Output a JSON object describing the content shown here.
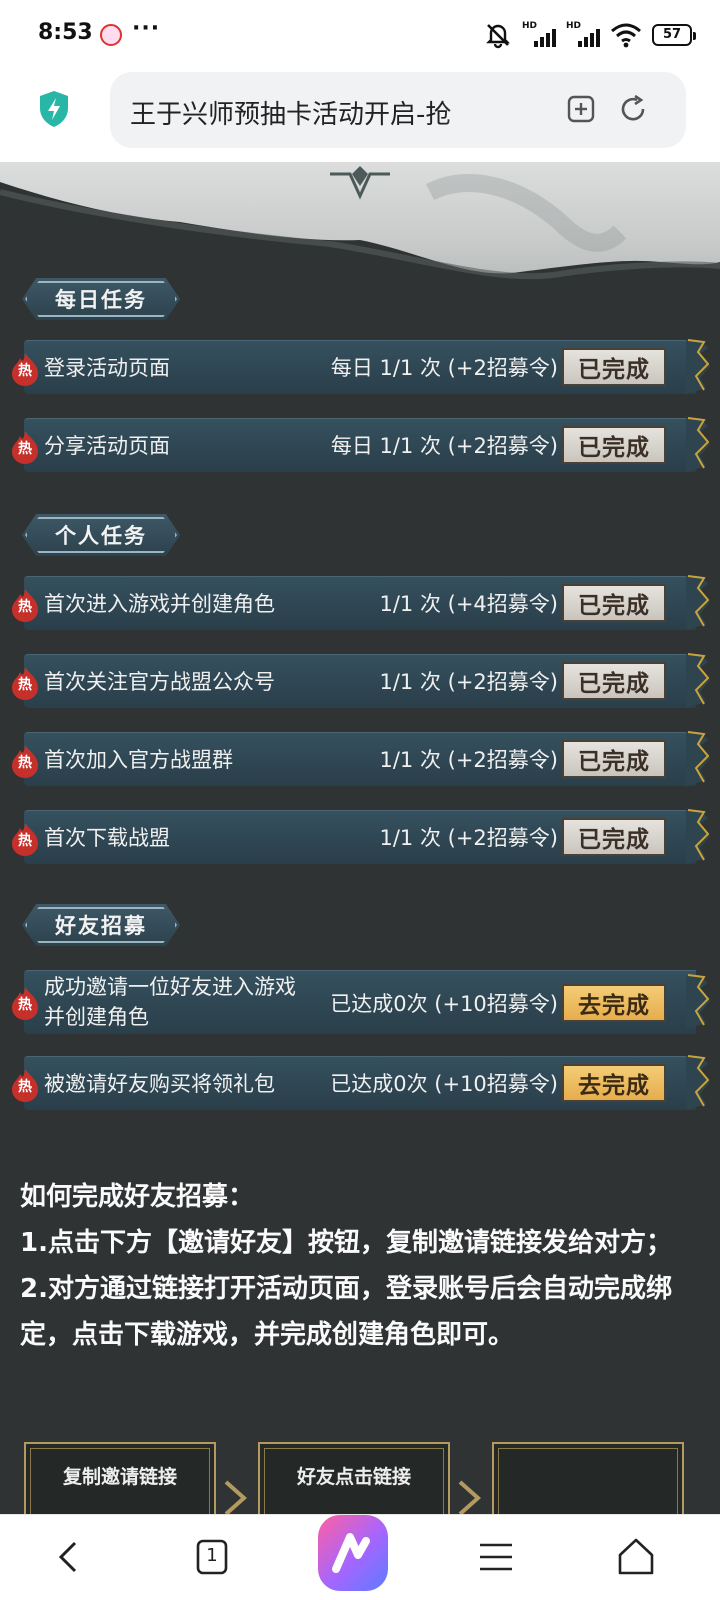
{
  "status_bar": {
    "time": "8:53",
    "more": "···",
    "signal_label": "HD",
    "battery": "57"
  },
  "browser": {
    "page_title": "王于兴师预抽卡活动开启-抢"
  },
  "sections": {
    "daily": "每日任务",
    "personal": "个人任务",
    "friends": "好友招募"
  },
  "hot_badge": "热",
  "daily_tasks": [
    {
      "name": "登录活动页面",
      "progress": "每日 1/1 次 (+2招募令)",
      "action": "已完成"
    },
    {
      "name": "分享活动页面",
      "progress": "每日 1/1 次 (+2招募令)",
      "action": "已完成"
    }
  ],
  "personal_tasks": [
    {
      "name": "首次进入游戏并创建角色",
      "progress": "1/1 次 (+4招募令)",
      "action": "已完成"
    },
    {
      "name": "首次关注官方战盟公众号",
      "progress": "1/1 次 (+2招募令)",
      "action": "已完成"
    },
    {
      "name": "首次加入官方战盟群",
      "progress": "1/1 次 (+2招募令)",
      "action": "已完成"
    },
    {
      "name": "首次下载战盟",
      "progress": "1/1 次 (+2招募令)",
      "action": "已完成"
    }
  ],
  "friend_tasks": [
    {
      "name": "成功邀请一位好友进入游戏并创建角色",
      "progress": "已达成0次 (+10招募令)",
      "action": "去完成"
    },
    {
      "name": "被邀请好友购买将领礼包",
      "progress": "已达成0次 (+10招募令)",
      "action": "去完成"
    }
  ],
  "howto": {
    "title": "如何完成好友招募：",
    "step1": "1.点击下方【邀请好友】按钮，复制邀请链接发给对方；",
    "step2": "2.对方通过链接打开活动页面，登录账号后会自动完成绑定，点击下载游戏，并完成创建角色即可。"
  },
  "flow_cards": {
    "card1": "复制邀请链接",
    "card2": "好友点击链接"
  },
  "navbar": {
    "tabs_count": "1"
  },
  "colors": {
    "done_button": "#d8d4ce",
    "todo_button": "#eebd60",
    "task_bar": "#2f4753",
    "accent_shield": "#28b7a7"
  }
}
